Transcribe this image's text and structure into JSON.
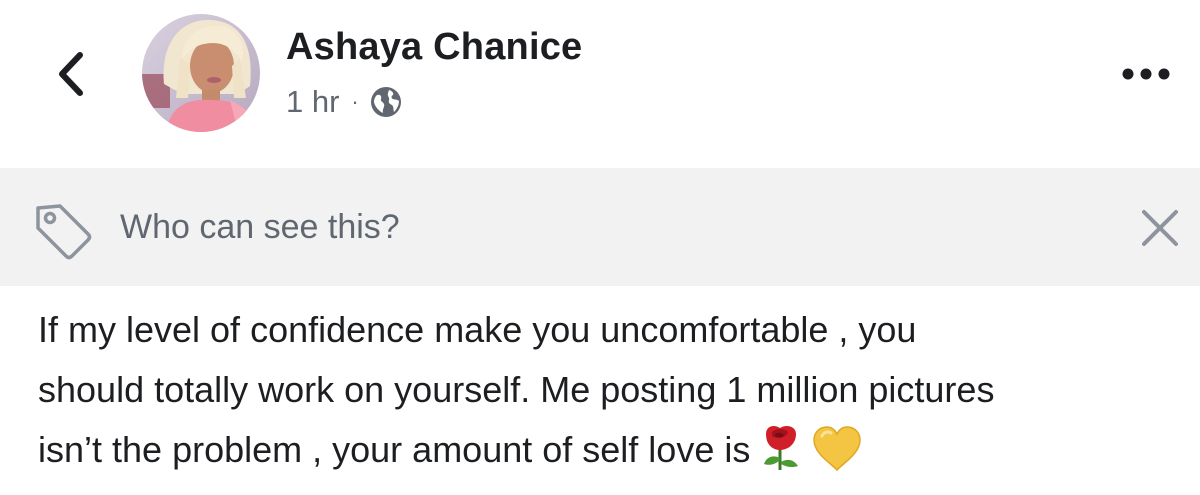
{
  "post": {
    "author": {
      "name": "Ashaya Chanice",
      "avatar_icon": "profile-photo"
    },
    "time": "1 hr",
    "separator": "·",
    "privacy_icon": "globe-icon",
    "text_lines": [
      "If my level of confidence make you uncomfortable , you",
      "should totally work on yourself. Me posting 1 million pictures",
      "isn’t the problem , your amount of self love is"
    ],
    "emojis": [
      "rose",
      "yellow-heart"
    ]
  },
  "header": {
    "back_icon": "chevron-left-icon",
    "more_icon": "more-dots-icon"
  },
  "audience_bar": {
    "text": "Who can see this?",
    "icon": "tag-icon",
    "close_icon": "close-icon"
  },
  "colors": {
    "text_primary": "#1c1e21",
    "text_secondary": "#606770",
    "bar_background": "#f2f2f2"
  }
}
